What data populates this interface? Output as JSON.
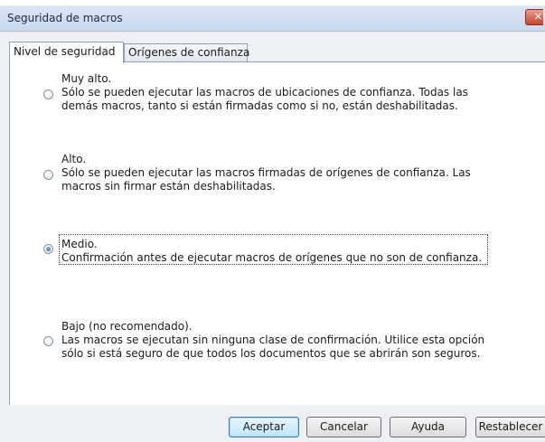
{
  "dialog": {
    "title": "Seguridad de macros"
  },
  "tabs": [
    {
      "label": "Nivel de seguridad",
      "active": true
    },
    {
      "label": "Orígenes de confianza",
      "active": false
    }
  ],
  "options": [
    {
      "title": "Muy alto.",
      "description": "Sólo se pueden ejecutar las macros de ubicaciones de confianza. Todas las demás macros, tanto si están firmadas como si no, están deshabilitadas.",
      "selected": false
    },
    {
      "title": "Alto.",
      "description": "Sólo se pueden ejecutar las macros firmadas de orígenes de confianza. Las macros sin firmar están deshabilitadas.",
      "selected": false
    },
    {
      "title": "Medio.",
      "description": "Confirmación antes de ejecutar macros de orígenes que no son de confianza.",
      "selected": true
    },
    {
      "title": "Bajo (no recomendado).",
      "description": "Las macros se ejecutan sin ninguna clase de confirmación. Utilice esta opción sólo si está seguro de que todos los documentos que se abrirán son seguros.",
      "selected": false
    }
  ],
  "buttons": {
    "ok": "Aceptar",
    "cancel": "Cancelar",
    "help": "Ayuda",
    "reset": "Restablecer"
  },
  "colors": {
    "accent": "#1e5fb3",
    "close": "#c4452c"
  }
}
